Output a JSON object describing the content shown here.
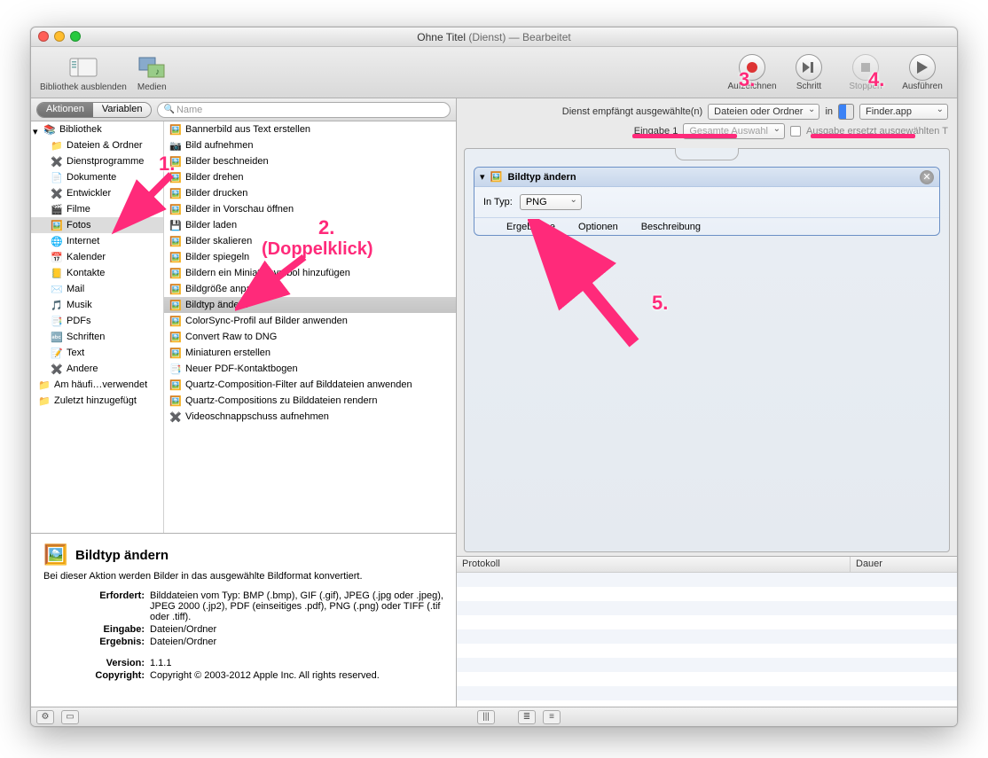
{
  "window": {
    "title_prefix": "Ohne Titel",
    "title_context": "(Dienst)",
    "title_suffix": " — Bearbeitet"
  },
  "toolbar": {
    "hide_library": "Bibliothek ausblenden",
    "media": "Medien",
    "record": "Aufzeichnen",
    "step": "Schritt",
    "stop": "Stoppen",
    "run": "Ausführen"
  },
  "tabs": {
    "actions": "Aktionen",
    "variables": "Variablen"
  },
  "search": {
    "placeholder": "Name",
    "glyph": "🔍"
  },
  "library_root": "Bibliothek",
  "library": [
    "Dateien & Ordner",
    "Dienstprogramme",
    "Dokumente",
    "Entwickler",
    "Filme",
    "Fotos",
    "Internet",
    "Kalender",
    "Kontakte",
    "Mail",
    "Musik",
    "PDFs",
    "Schriften",
    "Text",
    "Andere"
  ],
  "library_extra": [
    "Am häufi…verwendet",
    "Zuletzt hinzugefügt"
  ],
  "library_selected": "Fotos",
  "actions": [
    "Bannerbild aus Text erstellen",
    "Bild aufnehmen",
    "Bilder beschneiden",
    "Bilder drehen",
    "Bilder drucken",
    "Bilder in Vorschau öffnen",
    "Bilder laden",
    "Bilder skalieren",
    "Bilder spiegeln",
    "Bildern ein Miniatursymbol hinzufügen",
    "Bildgröße anpassen",
    "Bildtyp ändern",
    "ColorSync-Profil auf Bilder anwenden",
    "Convert Raw to DNG",
    "Miniaturen erstellen",
    "Neuer PDF-Kontaktbogen",
    "Quartz-Composition-Filter auf Bilddateien anwenden",
    "Quartz-Compositions zu Bilddateien rendern",
    "Videoschnappschuss aufnehmen"
  ],
  "action_selected": "Bildtyp ändern",
  "info": {
    "title": "Bildtyp ändern",
    "desc": "Bei dieser Aktion werden Bilder in das ausgewählte Bildformat konvertiert.",
    "requires_label": "Erfordert:",
    "requires": "Bilddateien vom Typ: BMP (.bmp), GIF (.gif), JPEG (.jpg oder .jpeg), JPEG 2000 (.jp2), PDF (einseitiges .pdf), PNG (.png) oder TIFF (.tif oder .tiff).",
    "input_label": "Eingabe:",
    "input": "Dateien/Ordner",
    "result_label": "Ergebnis:",
    "result": "Dateien/Ordner",
    "version_label": "Version:",
    "version": "1.1.1",
    "copyright_label": "Copyright:",
    "copyright": "Copyright © 2003-2012 Apple Inc.  All rights reserved."
  },
  "service": {
    "receives_label": "Dienst empfängt ausgewählte(n)",
    "receives_value": "Dateien oder Ordner",
    "in_label": "in",
    "app_value": "Finder.app",
    "input1_label": "Eingabe 1",
    "input1_value": "Gesamte Auswahl",
    "replace_label": "Ausgabe ersetzt ausgewählten T"
  },
  "step": {
    "title": "Bildtyp ändern",
    "intype_label": "In Typ:",
    "intype_value": "PNG",
    "tab_results": "Ergebnisse",
    "tab_options": "Optionen",
    "tab_desc": "Beschreibung"
  },
  "log": {
    "col1": "Protokoll",
    "col2": "Dauer"
  },
  "annotations": {
    "n1": "1.",
    "n2": "2.",
    "n2b": "(Doppelklick)",
    "n3": "3.",
    "n4": "4.",
    "n5": "5."
  }
}
